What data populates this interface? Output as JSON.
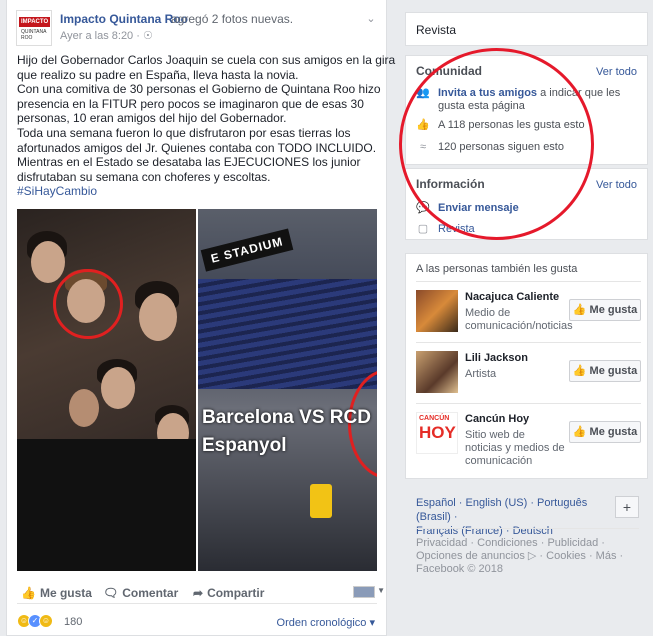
{
  "post": {
    "page_name": "Impacto Quintana Roo",
    "action_text": "agregó 2 fotos nuevas.",
    "time": "Ayer a las 8:20",
    "meta_sep": "·",
    "avatar_logo": "IMPACTO",
    "avatar_sub": "QUINTANA ROO",
    "lines": [
      "Hijo del Gobernador Carlos Joaquin se cuela con sus amigos en la gira",
      "que realizo su padre en España, lleva hasta la novia.",
      "Con una comitiva de 30 personas el Gobierno de Quintana Roo hizo",
      "presencia en la FITUR pero pocos se imaginaron que de esas 30",
      "personas, 10 eran amigos del hijo del Gobernador.",
      "Toda una semana fueron lo que disfrutaron por esas tierras los",
      "afortunados amigos del Jr. Quienes contaba con TODO INCLUIDO.",
      "Mientras en el Estado se desataba las EJECUCIONES los junior",
      "disfrutaban su semana con choferes y escoltas."
    ],
    "hashtag": "#SiHayCambio",
    "photo_right_label": "E STADIUM",
    "photo_right_text_1": "Barcelona VS RCD",
    "photo_right_text_2": "Espanyol",
    "like_label": "Me gusta",
    "comment_label": "Comentar",
    "share_label": "Compartir",
    "reaction_count": "180",
    "order_label": "Orden cronológico"
  },
  "sidebar": {
    "revista": "Revista",
    "community_title": "Comunidad",
    "see_all": "Ver todo",
    "invite_link": "Invita a tus amigos",
    "invite_rest": " a indicar que les gusta esta página",
    "likes_text": "A 118 personas les gusta esto",
    "follows_text": "120 personas siguen esto",
    "info_title": "Información",
    "info_see_all": "Ver todo",
    "send_message": "Enviar mensaje",
    "revista_link": "Revista",
    "also_like_title": "A las personas también les gusta",
    "suggestions": [
      {
        "name": "Nacajuca Caliente",
        "category": "Medio de comunicación/noticias",
        "button": "Me gusta"
      },
      {
        "name": "Lili Jackson",
        "category": "Artista",
        "button": "Me gusta"
      },
      {
        "name": "Cancún Hoy",
        "category": "Sitio web de noticias y medios de comunicación",
        "button": "Me gusta",
        "logo_text_1": "CANCÚN",
        "logo_text_2": "HOY"
      }
    ],
    "languages_line1": "Español · English (US) · Português (Brasil) ·",
    "languages_line2": "Français (France) · Deutsch",
    "plus": "+",
    "footer_line1": "Privacidad · Condiciones · Publicidad ·",
    "footer_line2": "Opciones de anuncios ▷ · Cookies · Más ·",
    "footer_line3": "Facebook © 2018"
  },
  "colors": {
    "link": "#365899",
    "annotation_red": "#e5192b",
    "background": "#e9ebee"
  }
}
